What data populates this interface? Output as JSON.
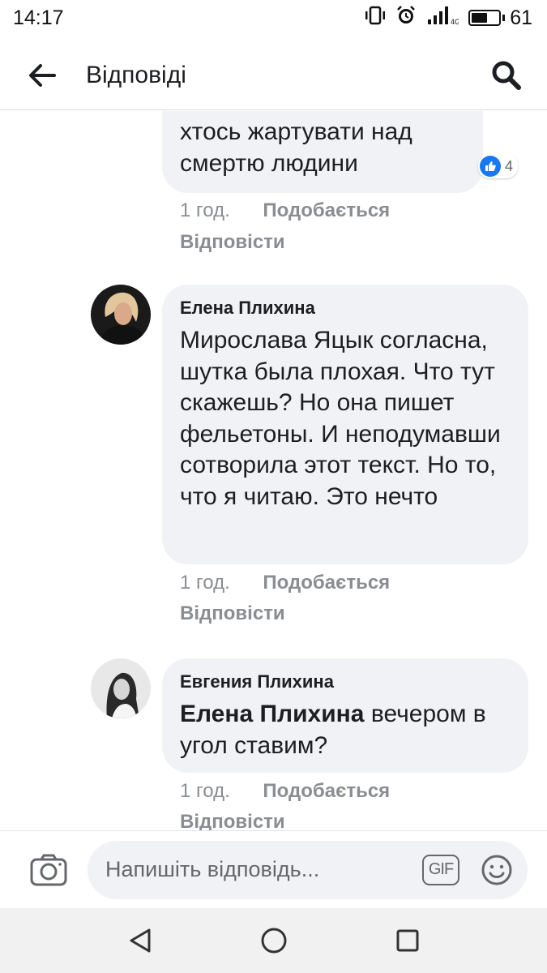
{
  "status_bar": {
    "time": "14:17",
    "network": "4G",
    "battery": "61",
    "battery_level": 0.61
  },
  "header": {
    "title": "Відповіді",
    "back_icon": "arrow-left-icon",
    "search_icon": "search-icon"
  },
  "comments": [
    {
      "text": "хтось жартувати над смертю людини",
      "reaction_count": "4",
      "time": "1 год.",
      "like_label": "Подобається",
      "reply_label": "Відповісти"
    },
    {
      "author": "Елена Плихина",
      "text": "Мирослава Яцык согласна, шутка была плохая. Что тут скажешь? Но она пишет фельетоны. И неподумавши сотворила этот текст. Но то, что я читаю. Это нечто",
      "time": "1 год.",
      "like_label": "Подобається",
      "reply_label": "Відповісти"
    },
    {
      "author": "Евгения Плихина",
      "mention": "Елена Плихина",
      "text": "вечером в угол ставим?",
      "time": "1 год.",
      "like_label": "Подобається",
      "reply_label": "Відповісти"
    }
  ],
  "composer": {
    "placeholder": "Напишіть відповідь...",
    "gif_label": "GIF",
    "camera_icon": "camera-icon",
    "emoji_icon": "smiley-icon"
  },
  "nav_bar": {
    "back_icon": "triangle-back-icon",
    "home_icon": "circle-home-icon",
    "recents_icon": "square-recents-icon"
  },
  "colors": {
    "bubble_bg": "#f0f2f5",
    "meta_text": "#8a8d91",
    "like_blue": "#1877f2",
    "nav_bg": "#f1f1f1"
  }
}
